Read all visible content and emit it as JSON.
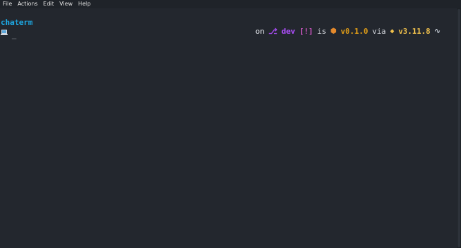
{
  "menubar": {
    "items": [
      "File",
      "Actions",
      "Edit",
      "View",
      "Help"
    ]
  },
  "terminal": {
    "line1": "chaterm",
    "prompt": {
      "cursor": "_",
      "icon": "laptop-icon"
    },
    "status": {
      "on": "on",
      "branch": "dev",
      "flags": "[!]",
      "is": "is",
      "version": "v0.1.0",
      "via": "via",
      "python": "v3.11.8",
      "icons": {
        "git": "git-branch-icon",
        "package": "package-icon",
        "python": "python-icon",
        "lizard": "lizard-icon"
      }
    }
  },
  "colors": {
    "bg": "#23272e",
    "accent_blue": "#1ea7e1",
    "git_purple": "#a64cf0",
    "flag_magenta": "#d157c4",
    "version_orange": "#e6a117",
    "python_yellow": "#f2c24c"
  }
}
